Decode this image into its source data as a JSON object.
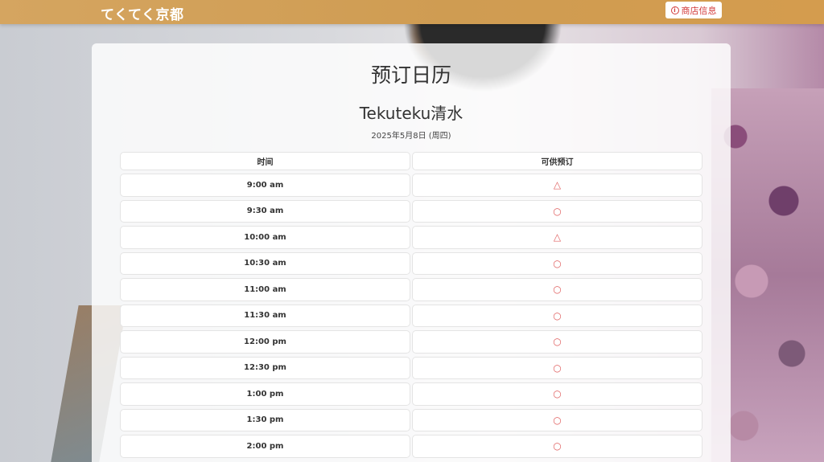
{
  "header": {
    "brand": "てくてく京都",
    "shop_info_label": "商店信息",
    "info_icon": "i"
  },
  "card": {
    "title": "预订日历",
    "shop_name": "Tekuteku清水",
    "date": "2025年5月8日 (周四)"
  },
  "table": {
    "columns": [
      "时间",
      "可供预订"
    ],
    "rows": [
      {
        "time": "9:00 am",
        "mark": "△"
      },
      {
        "time": "9:30 am",
        "mark": "○"
      },
      {
        "time": "10:00 am",
        "mark": "△"
      },
      {
        "time": "10:30 am",
        "mark": "○"
      },
      {
        "time": "11:00 am",
        "mark": "○"
      },
      {
        "time": "11:30 am",
        "mark": "○"
      },
      {
        "time": "12:00 pm",
        "mark": "○"
      },
      {
        "time": "12:30 pm",
        "mark": "○"
      },
      {
        "time": "1:00 pm",
        "mark": "○"
      },
      {
        "time": "1:30 pm",
        "mark": "○"
      },
      {
        "time": "2:00 pm",
        "mark": "○"
      }
    ]
  },
  "colors": {
    "header_bg": "#d5a560",
    "accent_red": "#d23a3a",
    "mark_color": "#e06060"
  }
}
